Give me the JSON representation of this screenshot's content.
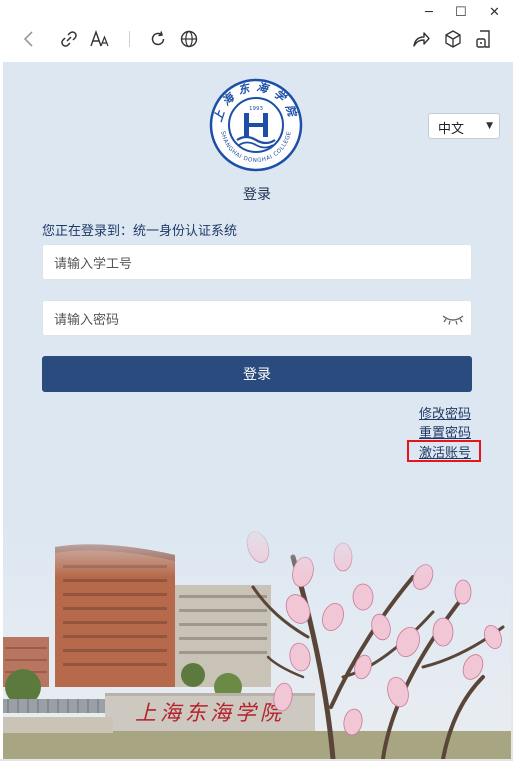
{
  "window": {
    "controls": {
      "minimize": "─",
      "maximize": "☐",
      "close": "✕"
    }
  },
  "toolbar": {
    "icons": [
      "back-icon",
      "link-icon",
      "text-size-icon",
      "refresh-icon",
      "globe-icon",
      "share-icon",
      "cube-icon",
      "device-icon"
    ]
  },
  "logo": {
    "school_name_cn": "上海东海学院",
    "school_name_en": "SHANGHAI DONGHAI COLLEGE",
    "year": "1993"
  },
  "language_select": {
    "value": "中文"
  },
  "login": {
    "title": "登录",
    "target_hint": "您正在登录到：统一身份认证系统",
    "username_placeholder": "请输入学工号",
    "password_placeholder": "请输入密码",
    "submit_label": "登录"
  },
  "links": {
    "change_password": "修改密码",
    "reset_password": "重置密码",
    "activate_account": "激活账号"
  },
  "campus_photo": {
    "gate_text": "上海东海学院"
  },
  "colors": {
    "background": "#dde7f2",
    "primary_button": "#2a4b7d",
    "link": "#1f3a66",
    "highlight_box": "#e6141b",
    "logo_blue": "#1d4fa8"
  }
}
